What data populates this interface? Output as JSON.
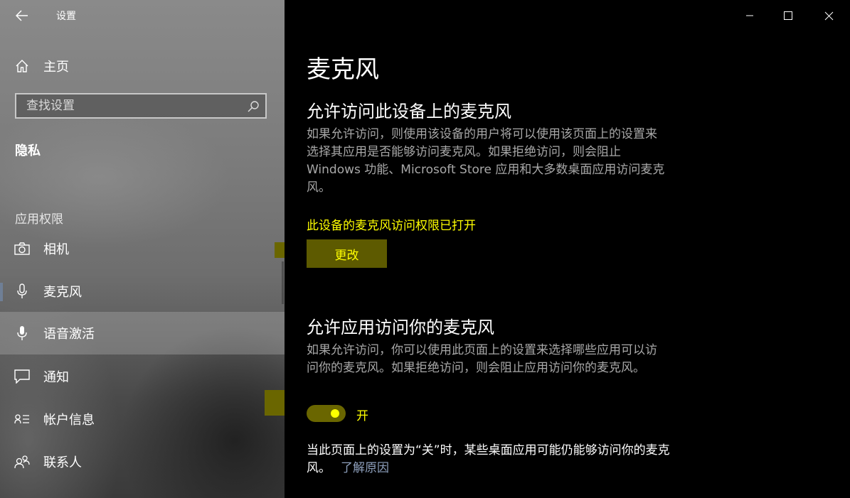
{
  "window": {
    "app_title": "设置"
  },
  "sidebar": {
    "home_label": "主页",
    "search_placeholder": "查找设置",
    "section_privacy": "隐私",
    "section_app_permissions": "应用权限",
    "items": [
      {
        "label": "相机",
        "icon": "camera-icon"
      },
      {
        "label": "麦克风",
        "icon": "microphone-icon"
      },
      {
        "label": "语音激活",
        "icon": "voice-microphone-icon"
      },
      {
        "label": "通知",
        "icon": "message-icon"
      },
      {
        "label": "帐户信息",
        "icon": "account-info-icon"
      },
      {
        "label": "联系人",
        "icon": "contacts-icon"
      }
    ]
  },
  "main": {
    "page_title": "麦克风",
    "device_section": {
      "heading": "允许访问此设备上的麦克风",
      "description_line1": "如果允许访问，则使用该设备的用户将可以使用该页面上的设置来",
      "description_line2": "选择其应用是否能够访问麦克风。如果拒绝访问，则会阻止",
      "description_line3": "Windows 功能、Microsoft Store 应用和大多数桌面应用访问麦克",
      "description_line4": "风。",
      "status_text": "此设备的麦克风访问权限已打开",
      "change_button": "更改"
    },
    "apps_section": {
      "heading": "允许应用访问你的麦克风",
      "description_line1": "如果允许访问，你可以使用此页面上的设置来选择哪些应用可以访",
      "description_line2": "问你的麦克风。如果拒绝访问，则会阻止应用访问你的麦克风。",
      "toggle_state": "开",
      "toggle_on": true
    },
    "footnote": {
      "line1": "当此页面上的设置为“关”时，某些桌面应用可能仍能够访问你的麦克",
      "line2": "风。",
      "link": "了解原因"
    }
  },
  "colors": {
    "accent_yellow": "#ffff00",
    "button_bg": "#5d5a00",
    "link": "#8ea0bd"
  }
}
